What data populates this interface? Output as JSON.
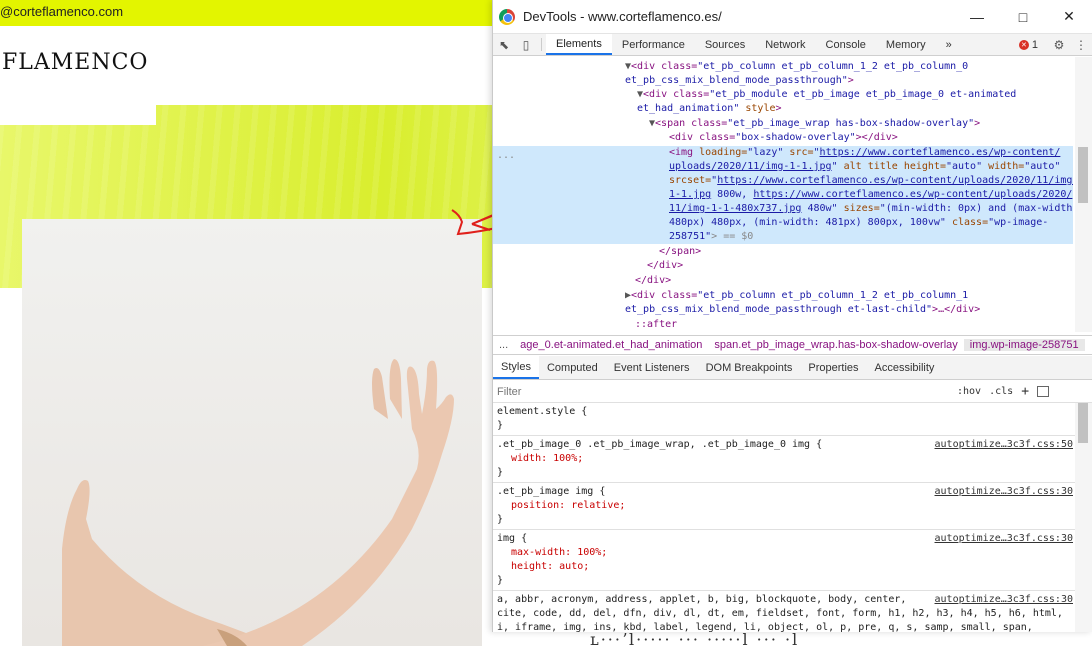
{
  "site": {
    "email": "@corteflamenco.com",
    "logo": "FLAMENCO",
    "below_text": "ʟ···ʼl·····  ···  ·····l ···  ·l"
  },
  "devtools": {
    "title": "DevTools - www.corteflamenco.es/",
    "tabs": [
      "Elements",
      "Performance",
      "Sources",
      "Network",
      "Console",
      "Memory"
    ],
    "more_tabs": "»",
    "error_count": "1",
    "code": {
      "l1_tag": "<div class=",
      "l1_val": "\"et_pb_column et_pb_column_1_2 et_pb_column_0",
      "l2_val": "et_pb_css_mix_blend_mode_passthrough\"",
      "l3_tag": "<div class=",
      "l3_val": "\"et_pb_module et_pb_image et_pb_image_0 et-animated",
      "l4_val": "et_had_animation\"",
      "l4_attr": " style",
      "l5_tag": "<span class=",
      "l5_val": "\"et_pb_image_wrap has-box-shadow-overlay\"",
      "l6_tag": "<div class=",
      "l6_val": "\"box-shadow-overlay\"",
      "l6_end": "></div>",
      "ellipsis": "...",
      "img_tag": "<img",
      "img_a1": " loading=",
      "img_v1": "\"lazy\"",
      "img_a2": " src=",
      "img_url1": "https://www.corteflamenco.es/wp-content/",
      "img_url2": "uploads/2020/11/img-1-1.jpg",
      "img_a3": " alt title height=",
      "img_v3": "\"auto\"",
      "img_a4": " width=",
      "img_v4": "\"auto\"",
      "srcset_a": "srcset=",
      "srcset_u1": "https://www.corteflamenco.es/wp-content/uploads/2020/11/img-",
      "srcset_u2": "1-1.jpg",
      "srcset_w1": " 800w, ",
      "srcset_u3": "https://www.corteflamenco.es/wp-content/uploads/2020/",
      "srcset_u4": "11/img-1-1-480x737.jpg",
      "srcset_w2": " 480w\"",
      "sizes_a": " sizes=",
      "sizes_v1": "\"(min-width: 0px) and (max-width:",
      "sizes_v2": "480px) 480px, (min-width: 481px) 800px, 100vw\"",
      "class_a": " class=",
      "class_v": "\"wp-image-",
      "class_v2": "258751\"",
      "eq0": "> == $0",
      "close_span": "</span>",
      "close_div1": "</div>",
      "close_div2": "</div>",
      "l_next_tag": "<div class=",
      "l_next_val": "\"et_pb_column et_pb_column_1_2 et_pb_column_1",
      "l_next2_val": "et_pb_css_mix_blend_mode_passthrough et-last-child\"",
      "l_next2_end": ">…</div>",
      "after": "::after"
    },
    "breadcrumbs": [
      "...",
      "age_0.et-animated.et_had_animation",
      "span.et_pb_image_wrap.has-box-shadow-overlay",
      "img.wp-image-258751"
    ],
    "subtabs": [
      "Styles",
      "Computed",
      "Event Listeners",
      "DOM Breakpoints",
      "Properties",
      "Accessibility"
    ],
    "filter_placeholder": "Filter",
    "filter_hov": ":hov",
    "filter_cls": ".cls",
    "filter_plus": "+",
    "styles": {
      "r0_sel": "element.style {",
      "r0_close": "}",
      "r1_sel": ".et_pb_image_0 .et_pb_image_wrap, .et_pb_image_0 img {",
      "r1_src": "autoptimize…3c3f.css:50",
      "r1_p1": "width: 100%;",
      "r2_sel": ".et_pb_image img {",
      "r2_src": "autoptimize…3c3f.css:30",
      "r2_p1": "position: relative;",
      "r3_sel": "img {",
      "r3_src": "autoptimize…3c3f.css:30",
      "r3_p1": "max-width: 100%;",
      "r3_p2": "height: auto;",
      "r4_sel1": "a, abbr, acronym, address, applet, b, big, blockquote, body, center,",
      "r4_sel2": "cite, code, dd, del, dfn, div, dl, dt, em, fieldset, font, form, h1, h2, h3, h4, h5, h6, html,",
      "r4_sel3": "i, iframe, img, ins, kbd, label, legend, li, object, ol, p, pre, q, s, samp, small, span,",
      "r4_src": "autoptimize…3c3f.css:30",
      "close": "}"
    },
    "colors": {
      "accent": "#1a73e8",
      "selected_row": "#cfe8fc",
      "site_yellow": "#e3f500",
      "annotation_red": "#e0201b"
    }
  }
}
